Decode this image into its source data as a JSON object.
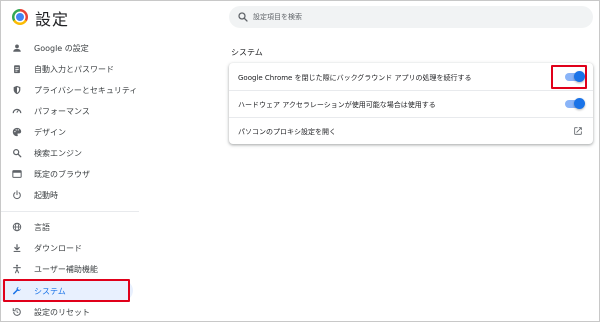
{
  "header": {
    "title": "設定",
    "logo_icon": "chrome-logo-icon"
  },
  "search": {
    "placeholder": "設定項目を検索",
    "icon": "search-icon"
  },
  "sidebar": {
    "items": [
      {
        "label": "Google の設定",
        "icon": "person-icon"
      },
      {
        "label": "自動入力とパスワード",
        "icon": "clipboard-icon"
      },
      {
        "label": "プライバシーとセキュリティ",
        "icon": "shield-icon"
      },
      {
        "label": "パフォーマンス",
        "icon": "speedometer-icon"
      },
      {
        "label": "デザイン",
        "icon": "palette-icon"
      },
      {
        "label": "検索エンジン",
        "icon": "search-icon"
      },
      {
        "label": "既定のブラウザ",
        "icon": "browser-icon"
      },
      {
        "label": "起動時",
        "icon": "power-icon"
      },
      {
        "label": "言語",
        "icon": "globe-icon"
      },
      {
        "label": "ダウンロード",
        "icon": "download-icon"
      },
      {
        "label": "ユーザー補助機能",
        "icon": "accessibility-icon"
      },
      {
        "label": "システム",
        "icon": "wrench-icon",
        "active": true
      },
      {
        "label": "設定のリセット",
        "icon": "reset-icon"
      }
    ]
  },
  "main": {
    "section_title": "システム",
    "rows": [
      {
        "label": "Google Chrome を閉じた際にバックグラウンド アプリの処理を続行する",
        "control": "toggle",
        "enabled": true
      },
      {
        "label": "ハードウェア アクセラレーションが使用可能な場合は使用する",
        "control": "toggle",
        "enabled": true
      },
      {
        "label": "パソコンのプロキシ設定を開く",
        "control": "external-link",
        "icon": "external-link-icon"
      }
    ]
  },
  "colors": {
    "accent": "#1a73e8",
    "active_bg": "#e8f0fe",
    "highlight": "#e0001a"
  }
}
